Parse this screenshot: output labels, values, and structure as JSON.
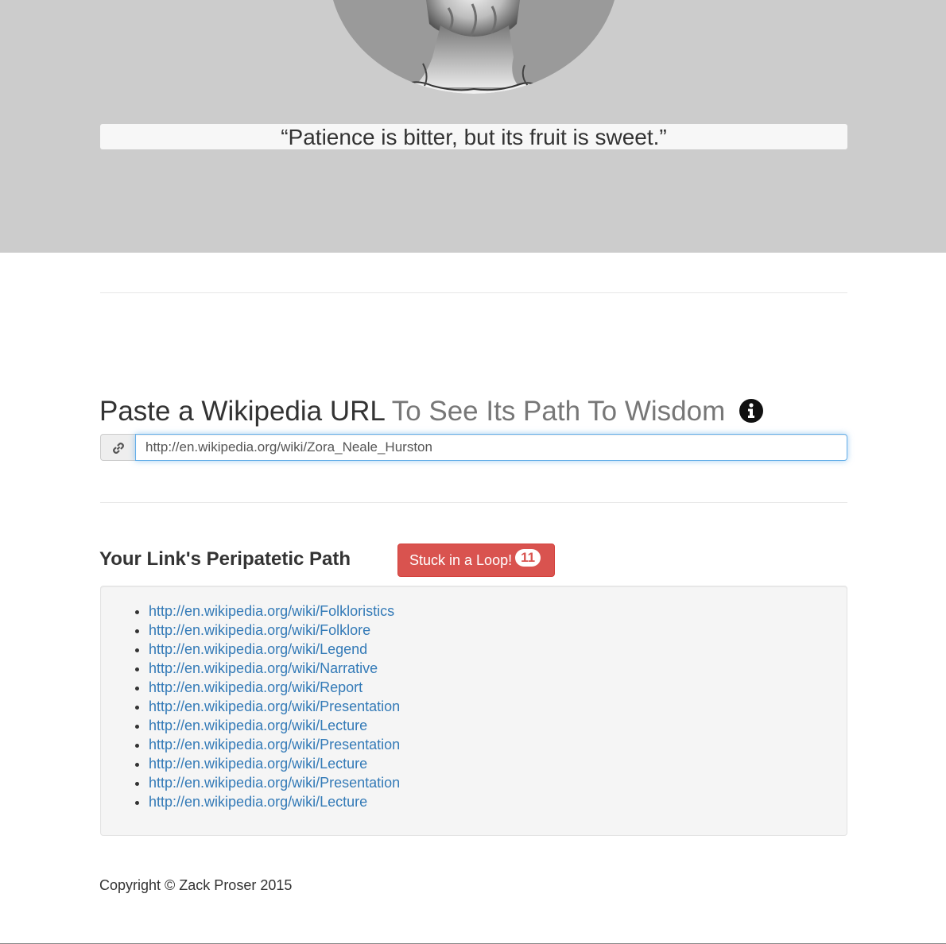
{
  "hero": {
    "quote": "“Patience is bitter, but its fruit is sweet.”"
  },
  "search": {
    "heading_strong": "Paste a Wikipedia URL",
    "heading_muted": "To See Its Path To Wisdom",
    "input_value": "http://en.wikipedia.org/wiki/Zora_Neale_Hurston"
  },
  "results": {
    "title": "Your Link's Peripatetic Path",
    "loop_button_label": "Stuck in a Loop!",
    "loop_count": "11",
    "links": [
      "http://en.wikipedia.org/wiki/Folkloristics",
      "http://en.wikipedia.org/wiki/Folklore",
      "http://en.wikipedia.org/wiki/Legend",
      "http://en.wikipedia.org/wiki/Narrative",
      "http://en.wikipedia.org/wiki/Report",
      "http://en.wikipedia.org/wiki/Presentation",
      "http://en.wikipedia.org/wiki/Lecture",
      "http://en.wikipedia.org/wiki/Presentation",
      "http://en.wikipedia.org/wiki/Lecture",
      "http://en.wikipedia.org/wiki/Presentation",
      "http://en.wikipedia.org/wiki/Lecture"
    ]
  },
  "footer": {
    "copyright": "Copyright © Zack Proser 2015"
  },
  "colors": {
    "hero_bg": "#cccccc",
    "danger": "#d9534f",
    "link": "#337ab7"
  },
  "icons": {
    "addon": "link-icon",
    "heading": "info-icon",
    "hero": "marble-bust-image"
  }
}
